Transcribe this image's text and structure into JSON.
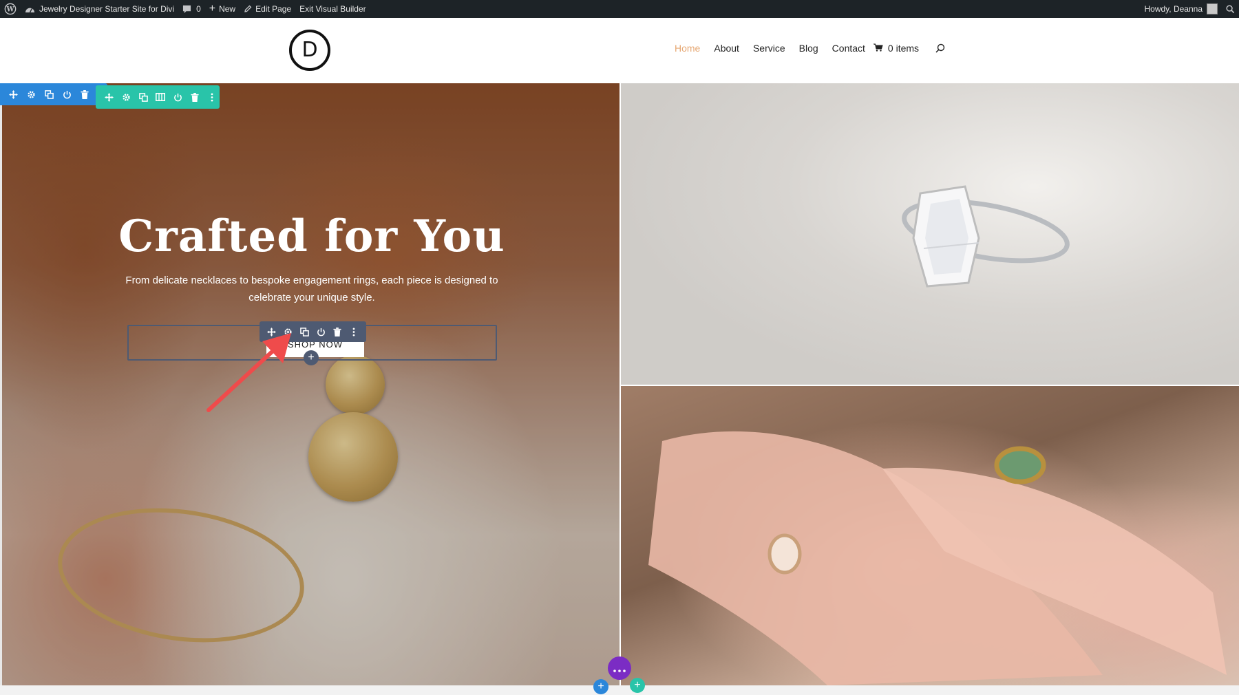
{
  "adminbar": {
    "site_title": "Jewelry Designer Starter Site for Divi",
    "comments_count": "0",
    "new_label": "New",
    "edit_page_label": "Edit Page",
    "exit_builder_label": "Exit Visual Builder",
    "greeting": "Howdy, Deanna"
  },
  "header": {
    "logo_letter": "D",
    "nav": [
      "Home",
      "About",
      "Service",
      "Blog",
      "Contact"
    ],
    "active_nav": "Home",
    "cart_label": "0 items"
  },
  "hero": {
    "title": "Crafted for You",
    "subtitle": "From delicate necklaces to bespoke engagement rings, each piece is designed to celebrate your unique style.",
    "button_label": "SHOP NOW"
  },
  "colors": {
    "admin_bar": "#1d2327",
    "nav_active": "#e6a874",
    "section_toolbar": "#2b87da",
    "row_toolbar": "#29c4a9",
    "module_toolbar": "#4e5a72",
    "page_settings": "#7b2cc4",
    "annotation_arrow": "#ef4b4b"
  },
  "icons": {
    "toolbar": [
      "move-icon",
      "gear-icon",
      "duplicate-icon",
      "power-icon",
      "trash-icon",
      "more-icon"
    ],
    "row_toolbar_extra": "columns-icon"
  }
}
